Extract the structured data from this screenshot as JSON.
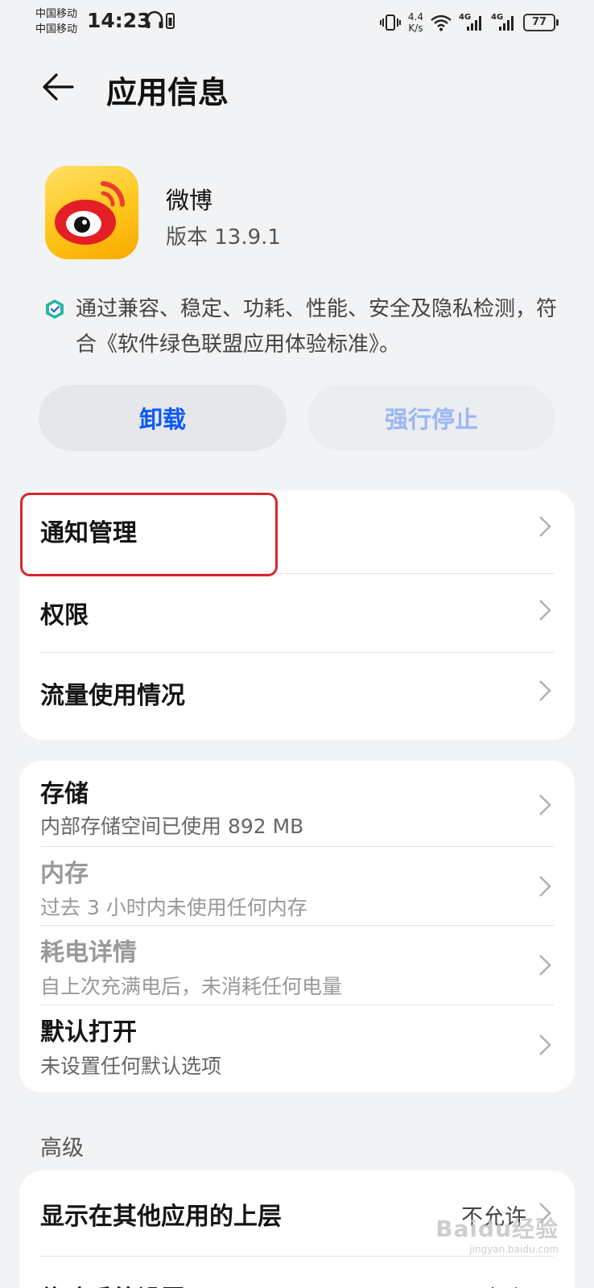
{
  "status_bar": {
    "carrier_1": "中国移动",
    "carrier_2": "中国移动",
    "time": "14:23",
    "net_speed_value": "4.4",
    "net_speed_unit": "K/s",
    "signal_1_label": "4G",
    "signal_2_label": "4G",
    "battery": "77"
  },
  "header": {
    "title": "应用信息"
  },
  "app": {
    "name": "微博",
    "version": "版本 13.9.1",
    "certification": "通过兼容、稳定、功耗、性能、安全及隐私检测，符合《软件绿色联盟应用体验标准》。"
  },
  "actions": {
    "uninstall": "卸载",
    "force_stop": "强行停止"
  },
  "group1": [
    {
      "label": "通知管理"
    },
    {
      "label": "权限"
    },
    {
      "label": "流量使用情况"
    }
  ],
  "group2": [
    {
      "label": "存储",
      "sub": "内部存储空间已使用 892 MB"
    },
    {
      "label": "内存",
      "sub": "过去 3 小时内未使用任何内存"
    },
    {
      "label": "耗电详情",
      "sub": "自上次充满电后，未消耗任何电量"
    },
    {
      "label": "默认打开",
      "sub": "未设置任何默认选项"
    }
  ],
  "advanced": {
    "section_title": "高级",
    "items": [
      {
        "label": "显示在其他应用的上层",
        "value": "不允许"
      },
      {
        "label": "修改系统设置",
        "value": "不允许"
      }
    ]
  },
  "watermark": {
    "main": "Baidu经验",
    "sub": "jingyan.baidu.com"
  },
  "colors": {
    "accent": "#0a59f7",
    "highlight": "#d8262c",
    "background": "#f1f3f5"
  }
}
